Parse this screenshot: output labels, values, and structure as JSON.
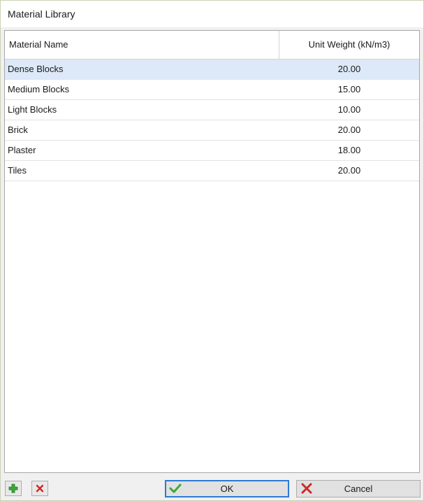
{
  "window": {
    "title": "Material Library"
  },
  "table": {
    "headers": {
      "name": "Material Name",
      "unit_weight": "Unit Weight (kN/m3)"
    },
    "rows": [
      {
        "name": "Dense Blocks",
        "unit_weight": "20.00",
        "selected": true
      },
      {
        "name": "Medium Blocks",
        "unit_weight": "15.00",
        "selected": false
      },
      {
        "name": "Light Blocks",
        "unit_weight": "10.00",
        "selected": false
      },
      {
        "name": "Brick",
        "unit_weight": "20.00",
        "selected": false
      },
      {
        "name": "Plaster",
        "unit_weight": "18.00",
        "selected": false
      },
      {
        "name": "Tiles",
        "unit_weight": "20.00",
        "selected": false
      }
    ]
  },
  "footer": {
    "add_icon": "plus-icon",
    "delete_icon": "delete-icon",
    "ok_label": "OK",
    "ok_icon": "check-icon",
    "cancel_label": "Cancel",
    "cancel_icon": "cross-icon"
  },
  "colors": {
    "selected_row": "#dde8f8",
    "ok_border": "#2b7bd3",
    "add_icon": "#3aa83a",
    "delete_icon": "#d02828"
  }
}
